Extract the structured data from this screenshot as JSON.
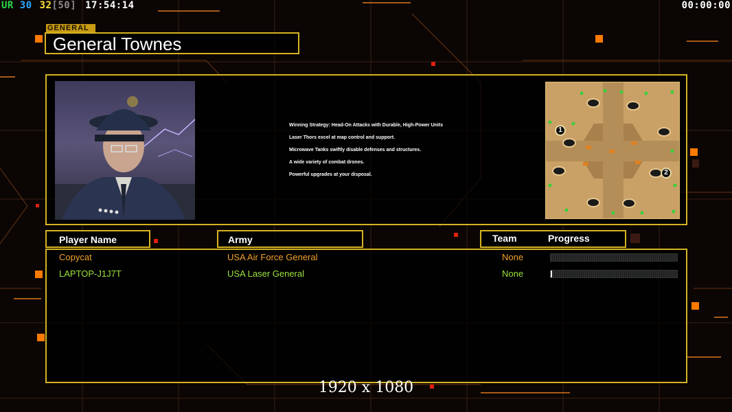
{
  "hud": {
    "label": "UR",
    "value_a": "30",
    "value_b": "32",
    "value_c": "[50]",
    "clock": "17:54:14",
    "timer": "00:00:00",
    "colors": {
      "label": "#2bd84a",
      "value_a": "#29a8ff",
      "value_b": "#ffe23a",
      "value_c": "#8a8a8a"
    }
  },
  "general": {
    "tag": "GENERAL",
    "name": "General Townes"
  },
  "briefing": {
    "lines": [
      "Winning Strategy: Head-On Attacks with Durable, High-Power Units",
      "Laser Thors excel at map control and support.",
      "Microwave Tanks swiftly disable defenses and structures.",
      "A wide variety of combat drones.",
      "Powerful upgrades at your disposal."
    ]
  },
  "minimap": {
    "start_positions": [
      "1",
      "2"
    ]
  },
  "columns": {
    "player": "Player Name",
    "army": "Army",
    "team": "Team",
    "progress": "Progress"
  },
  "players": [
    {
      "name": "Copycat",
      "army": "USA Air Force General",
      "team": "None",
      "progress": 0,
      "color": "#f0a22a"
    },
    {
      "name": "LAPTOP-J1J7T",
      "army": "USA Laser General",
      "team": "None",
      "progress": 0.01,
      "color": "#9be23c"
    }
  ],
  "resolution": "1920 x 1080",
  "colors": {
    "frame": "#d6b422",
    "accent": "#ff8a00"
  }
}
